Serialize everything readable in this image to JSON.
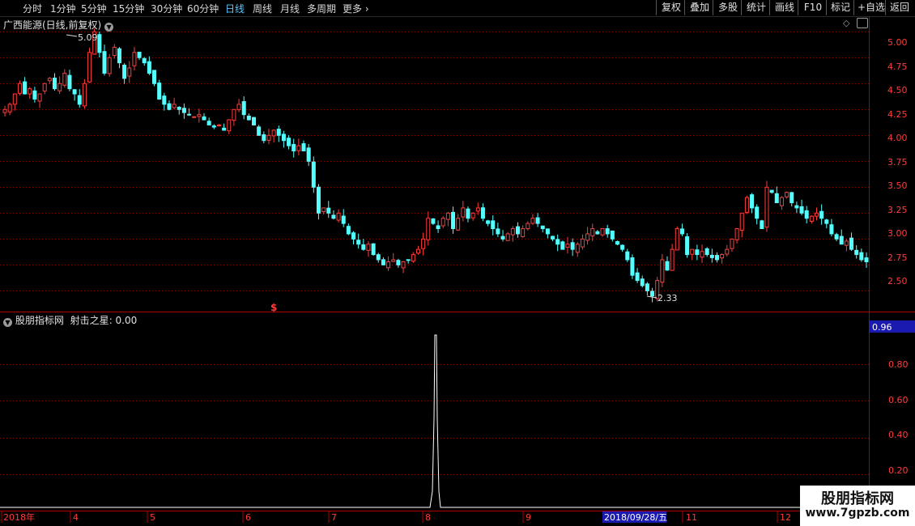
{
  "toolbar": {
    "periods": [
      "分时",
      "1分钟",
      "5分钟",
      "15分钟",
      "30分钟",
      "60分钟",
      "日线",
      "周线",
      "月线",
      "多周期",
      "更多"
    ],
    "active_period": "日线",
    "buttons": [
      "复权",
      "叠加",
      "多股",
      "统计",
      "画线",
      "F10",
      "+自选",
      "返回"
    ]
  },
  "main_panel": {
    "title": "广西能源(日线,前复权)",
    "high_label": "5.09",
    "low_label": "2.33",
    "marker": "$",
    "price_ticks": [
      "5.00",
      "4.75",
      "4.50",
      "4.25",
      "4.00",
      "3.75",
      "3.50",
      "3.25",
      "3.00",
      "2.75",
      "2.50"
    ]
  },
  "indicator_panel": {
    "title": "股朋指标网",
    "indicator_name": "射击之星",
    "indicator_value": "0.00",
    "current_value": "0.96",
    "ticks": [
      "0.80",
      "0.60",
      "0.40",
      "0.20"
    ]
  },
  "time_axis": {
    "labels": [
      "2018年",
      "4",
      "5",
      "6",
      "7",
      "8",
      "9",
      "11",
      "12"
    ],
    "cursor_date": "2018/09/28/五"
  },
  "watermark": {
    "line1": "股朋指标网",
    "line2": "www.7gpzb.com"
  },
  "colors": {
    "up": "#ff3c3c",
    "down": "#54ffff",
    "grid": "#8b0000",
    "axis": "#b00000",
    "cursor_bg": "#1a1ab0"
  },
  "chart_data": {
    "type": "candlestick",
    "ylim": [
      2.3,
      5.15
    ],
    "closes": [
      4.25,
      4.3,
      4.4,
      4.5,
      4.4,
      4.45,
      4.35,
      4.4,
      4.5,
      4.55,
      4.45,
      4.5,
      4.6,
      4.45,
      4.4,
      4.3,
      4.5,
      4.8,
      5.0,
      4.8,
      4.6,
      4.75,
      4.85,
      4.7,
      4.55,
      4.65,
      4.8,
      4.75,
      4.7,
      4.6,
      4.5,
      4.35,
      4.3,
      4.25,
      4.3,
      4.25,
      4.22,
      4.2,
      4.18,
      4.2,
      4.15,
      4.1,
      4.08,
      4.1,
      4.05,
      4.15,
      4.25,
      4.3,
      4.2,
      4.15,
      4.1,
      4.0,
      3.95,
      4.0,
      4.05,
      4.0,
      3.95,
      3.9,
      3.85,
      3.9,
      3.85,
      3.75,
      3.5,
      3.25,
      3.3,
      3.25,
      3.2,
      3.25,
      3.15,
      3.05,
      3.0,
      2.95,
      2.9,
      2.95,
      2.85,
      2.8,
      2.75,
      2.78,
      2.8,
      2.75,
      2.78,
      2.8,
      2.85,
      2.9,
      3.0,
      3.2,
      3.15,
      3.1,
      3.2,
      3.25,
      3.1,
      3.2,
      3.3,
      3.2,
      3.25,
      3.3,
      3.2,
      3.15,
      3.1,
      3.05,
      3.0,
      3.05,
      3.1,
      3.05,
      3.1,
      3.15,
      3.2,
      3.15,
      3.1,
      3.05,
      3.0,
      2.95,
      2.9,
      2.95,
      2.9,
      2.95,
      3.0,
      3.05,
      3.1,
      3.05,
      3.1,
      3.05,
      3.0,
      2.95,
      2.9,
      2.8,
      2.65,
      2.6,
      2.55,
      2.5,
      2.45,
      2.6,
      2.8,
      2.7,
      2.9,
      3.1,
      3.05,
      2.85,
      2.9,
      2.85,
      2.88,
      2.85,
      2.82,
      2.8,
      2.85,
      2.9,
      3.0,
      3.1,
      3.25,
      3.4,
      3.3,
      3.2,
      3.1,
      3.5,
      3.45,
      3.35,
      3.4,
      3.45,
      3.35,
      3.3,
      3.25,
      3.2,
      3.22,
      3.25,
      3.2,
      3.15,
      3.05,
      3.0,
      2.95,
      2.98,
      2.9,
      2.85,
      2.8,
      2.78
    ]
  }
}
